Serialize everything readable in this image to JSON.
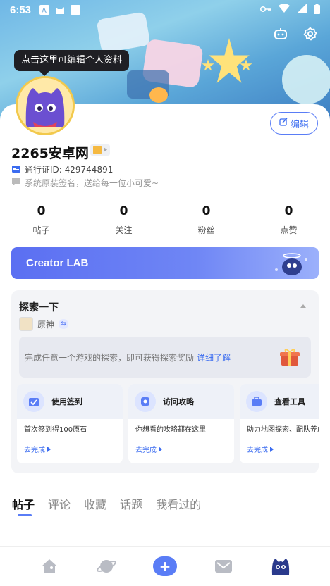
{
  "status_bar": {
    "time": "6:53"
  },
  "tooltip": "点击这里可编辑个人资料",
  "edit_button": "编辑",
  "profile": {
    "username": "2265安卓网",
    "pass_id": "通行证ID: 429744891",
    "signature": "系统原装签名，送给每一位小可爱~"
  },
  "stats": [
    {
      "value": "0",
      "label": "帖子"
    },
    {
      "value": "0",
      "label": "关注"
    },
    {
      "value": "0",
      "label": "粉丝"
    },
    {
      "value": "0",
      "label": "点赞"
    }
  ],
  "creator_lab": "Creator LAB",
  "explore": {
    "title": "探索一下",
    "game": "原神",
    "hint": "完成任意一个游戏的探索，即可获得探索奖励",
    "hint_link": "详细了解",
    "tasks": [
      {
        "title": "使用签到",
        "desc": "首次签到得100原石",
        "action": "去完成"
      },
      {
        "title": "访问攻略",
        "desc": "你想看的攻略都在这里",
        "action": "去完成"
      },
      {
        "title": "查看工具",
        "desc": "助力地图探索、配队养成",
        "action": "去完成"
      }
    ]
  },
  "tabs": [
    "帖子",
    "评论",
    "收藏",
    "话题",
    "我看过的"
  ],
  "colors": {
    "accent": "#5a7df6",
    "creator_gradient_start": "#5b6ff2"
  },
  "icons": {
    "top_actions": [
      "robot-icon",
      "settings-icon"
    ],
    "bottom_nav": [
      "home-icon",
      "planet-icon",
      "plus-icon",
      "message-icon",
      "profile-mascot-icon"
    ]
  }
}
